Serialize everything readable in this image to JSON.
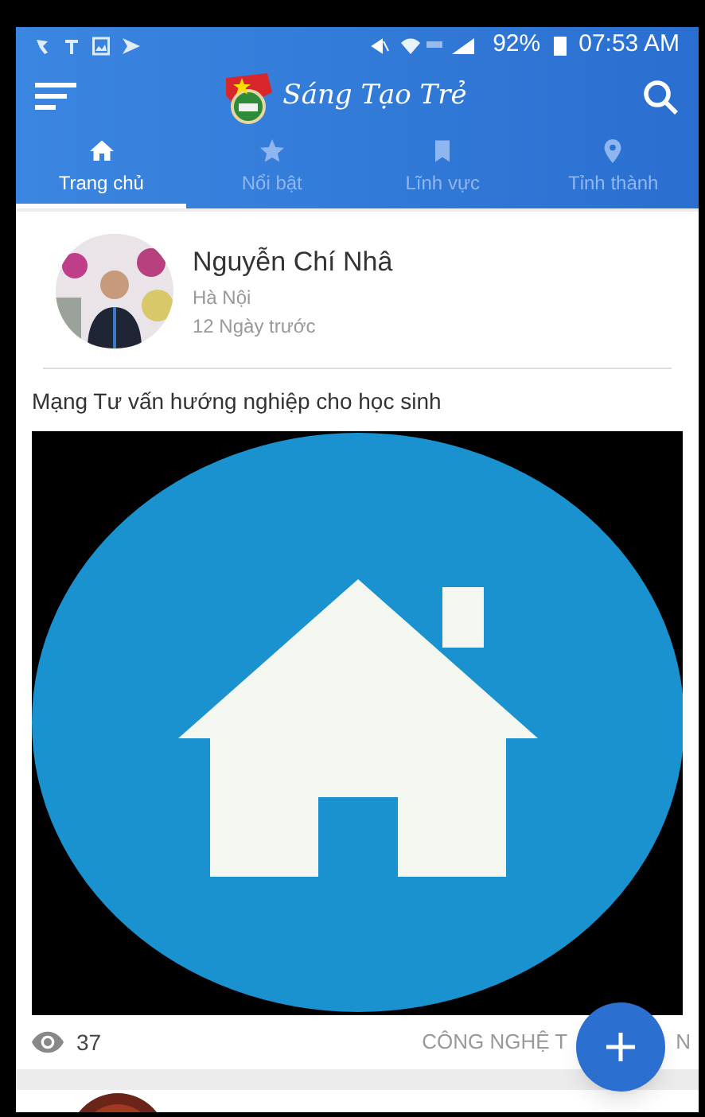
{
  "status_bar": {
    "battery": "92%",
    "time": "07:53 AM"
  },
  "app_bar": {
    "title": "Sáng Tạo Trẻ"
  },
  "tabs": [
    {
      "label": "Trang chủ",
      "kind": "home",
      "selected": true
    },
    {
      "label": "Nổi bật",
      "kind": "star",
      "selected": false
    },
    {
      "label": "Lĩnh vực",
      "kind": "bookmark",
      "selected": false
    },
    {
      "label": "Tỉnh thành",
      "kind": "pin",
      "selected": false
    }
  ],
  "post": {
    "author": "Nguyễn Chí Nhâ",
    "location": "Hà Nội",
    "time": "12 Ngày trước",
    "title": "Mạng Tư vấn hướng nghiệp cho học sinh",
    "views": "37",
    "category_parts": [
      "CÔNG NGHỆ T",
      "N"
    ]
  }
}
